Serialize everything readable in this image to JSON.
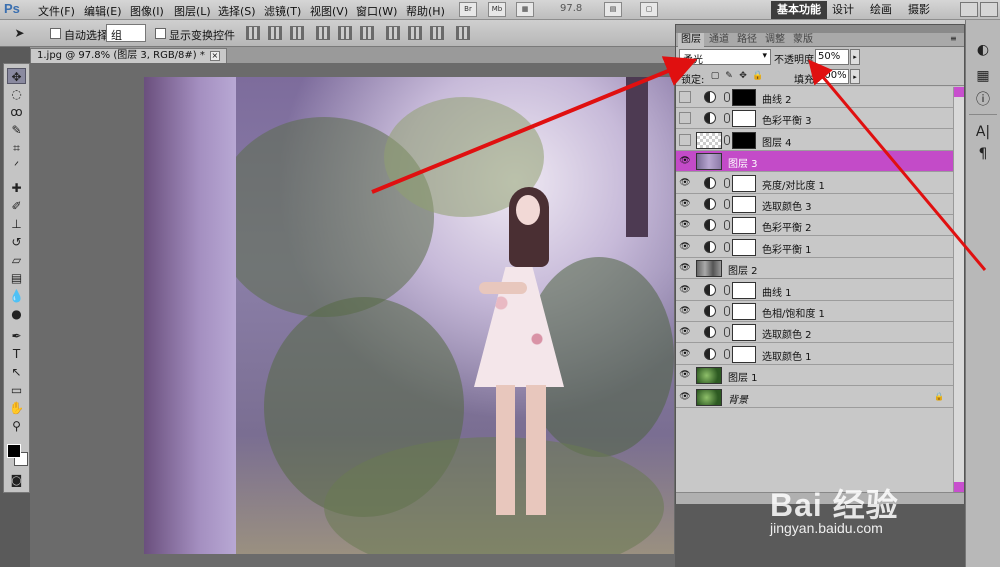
{
  "app": {
    "logo": "Ps"
  },
  "menubar": {
    "items": [
      "文件(F)",
      "编辑(E)",
      "图像(I)",
      "图层(L)",
      "选择(S)",
      "滤镜(T)",
      "视图(V)",
      "窗口(W)",
      "帮助(H)"
    ],
    "zoom": "97.8",
    "workspaces": [
      "基本功能",
      "设计",
      "绘画",
      "摄影"
    ],
    "active_workspace": "基本功能"
  },
  "options": {
    "auto_select_label": "自动选择:",
    "auto_select_value": "组",
    "show_transform_label": "显示变换控件"
  },
  "document": {
    "tab_title": "1.jpg @ 97.8% (图层 3, RGB/8#) *",
    "close": "×"
  },
  "layers_panel": {
    "tabs": [
      "图层",
      "通道",
      "路径",
      "调整",
      "蒙版"
    ],
    "active_tab": "图层",
    "blend_mode": "柔光",
    "opacity_label": "不透明度:",
    "opacity_value": "50%",
    "lock_label": "锁定:",
    "fill_label": "填充:",
    "fill_value": "100%",
    "layers": [
      {
        "name": "曲线 2",
        "kind": "adjustment",
        "visible": false,
        "mask": "black"
      },
      {
        "name": "色彩平衡 3",
        "kind": "adjustment",
        "visible": false,
        "mask": "white"
      },
      {
        "name": "图层 4",
        "kind": "pixel-mask",
        "visible": false,
        "mask": "black"
      },
      {
        "name": "图层 3",
        "kind": "pixel",
        "visible": true,
        "selected": true
      },
      {
        "name": "亮度/对比度 1",
        "kind": "adjustment",
        "visible": true,
        "mask": "white"
      },
      {
        "name": "选取颜色 3",
        "kind": "adjustment",
        "visible": true,
        "mask": "white"
      },
      {
        "name": "色彩平衡 2",
        "kind": "adjustment",
        "visible": true,
        "mask": "white"
      },
      {
        "name": "色彩平衡 1",
        "kind": "adjustment",
        "visible": true,
        "mask": "white"
      },
      {
        "name": "图层 2",
        "kind": "pixel",
        "visible": true
      },
      {
        "name": "曲线 1",
        "kind": "adjustment",
        "visible": true,
        "mask": "white"
      },
      {
        "name": "色相/饱和度 1",
        "kind": "adjustment",
        "visible": true,
        "mask": "white"
      },
      {
        "name": "选取颜色 2",
        "kind": "adjustment",
        "visible": true,
        "mask": "white"
      },
      {
        "name": "选取颜色 1",
        "kind": "adjustment",
        "visible": true,
        "mask": "white"
      },
      {
        "name": "图层 1",
        "kind": "pixel",
        "visible": true
      },
      {
        "name": "背景",
        "kind": "background",
        "visible": true,
        "locked": true
      }
    ]
  },
  "watermark": {
    "logo": "Bai 经验",
    "url": "jingyan.baidu.com"
  },
  "colors": {
    "selected_layer": "#c34bc8",
    "annotation_arrow": "#e01010",
    "workspace_active": "#3c3c3c"
  }
}
